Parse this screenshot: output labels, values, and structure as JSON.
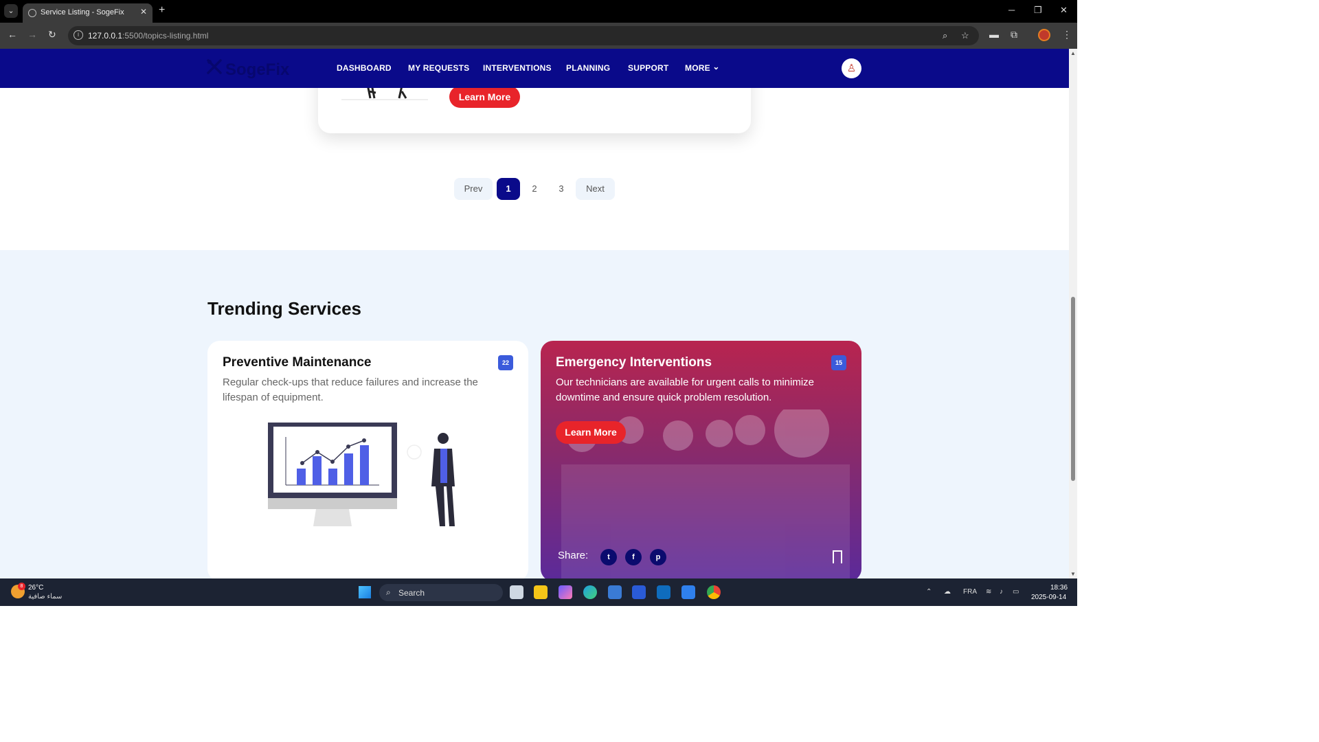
{
  "browser": {
    "tab_title": "Service Listing - SogeFix",
    "url_host": "127.0.0.1",
    "url_path": ":5500/topics-listing.html"
  },
  "site": {
    "logo": "SogeFix",
    "menu": [
      "DASHBOARD",
      "MY REQUESTS",
      "INTERVENTIONS",
      "PLANNING",
      "SUPPORT",
      "MORE"
    ]
  },
  "prev_card": {
    "button_label": "Learn More"
  },
  "pagination": {
    "prev": "Prev",
    "pages": [
      "1",
      "2",
      "3"
    ],
    "next": "Next",
    "current": "1"
  },
  "trending": {
    "heading": "Trending Services",
    "cards": [
      {
        "title": "Preventive Maintenance",
        "badge": "22",
        "description": "Regular check-ups that reduce failures and increase the lifespan of equipment."
      },
      {
        "title": "Emergency Interventions",
        "badge": "15",
        "description": "Our technicians are available for urgent calls to minimize downtime and ensure quick problem resolution.",
        "button_label": "Learn More",
        "share_label": "Share:",
        "share_icons": [
          "twitter-icon",
          "facebook-icon",
          "pinterest-icon"
        ]
      }
    ]
  },
  "taskbar": {
    "weather_temp": "26°C",
    "weather_desc": "سماء صافية",
    "weather_badge": "8",
    "search_label": "Search",
    "language": "FRA",
    "time": "18:36",
    "date": "2025-09-14"
  },
  "colors": {
    "brand_navy": "#0a0a8a",
    "accent_red": "#e8242a",
    "badge_blue": "#3b5bdb"
  }
}
